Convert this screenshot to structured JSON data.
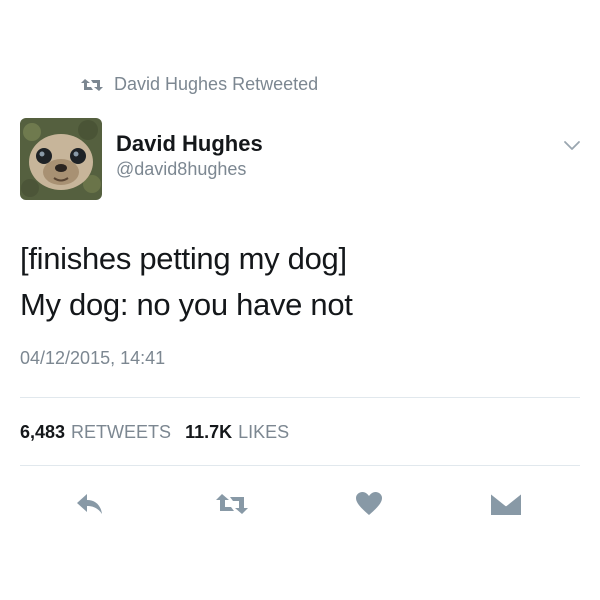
{
  "retweet_header": {
    "text": "David Hughes Retweeted",
    "icon": "retweet-icon"
  },
  "author": {
    "display_name": "David Hughes",
    "handle": "@david8hughes",
    "avatar_icon": "avatar"
  },
  "tweet": {
    "lines": [
      "[finishes petting my dog]",
      "My dog: no you have not"
    ],
    "timestamp": "04/12/2015, 14:41"
  },
  "stats": {
    "retweets_count": "6,483",
    "retweets_label": "RETWEETS",
    "likes_count": "11.7K",
    "likes_label": "LIKES"
  },
  "actions": [
    {
      "name": "reply",
      "icon": "reply-icon"
    },
    {
      "name": "retweet",
      "icon": "retweet-icon"
    },
    {
      "name": "like",
      "icon": "heart-icon"
    },
    {
      "name": "direct-message",
      "icon": "envelope-icon"
    }
  ],
  "colors": {
    "text_primary": "#14171a",
    "text_secondary": "#7c8791",
    "divider": "#e1e8ed",
    "icon": "#8899a6"
  }
}
